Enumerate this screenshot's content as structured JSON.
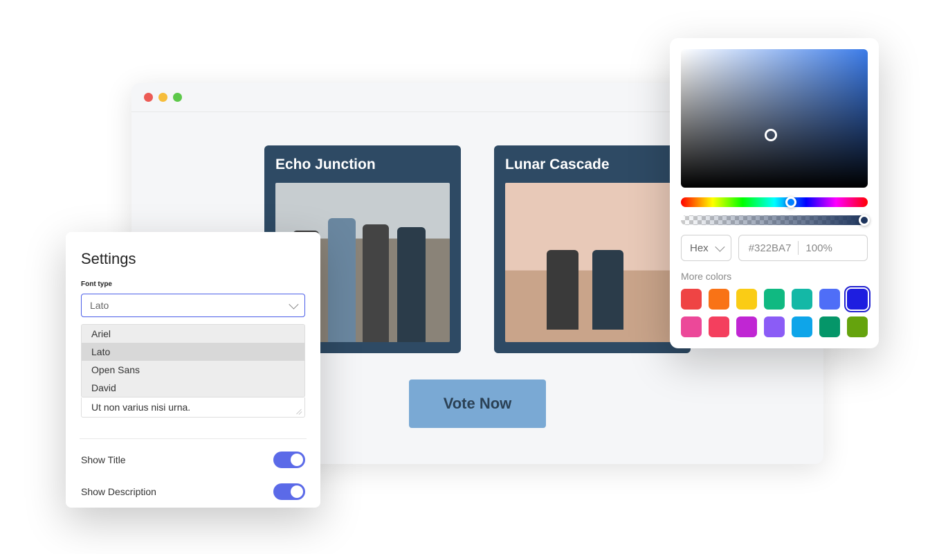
{
  "browser": {
    "cards": [
      {
        "title": "Echo Junction"
      },
      {
        "title": "Lunar Cascade"
      }
    ],
    "vote_button_label": "Vote Now"
  },
  "settings": {
    "title": "Settings",
    "font_type_label": "Font type",
    "font_selected": "Lato",
    "font_options": [
      "Ariel",
      "Lato",
      "Open Sans",
      "David"
    ],
    "textarea_value": "Ut non varius nisi urna.",
    "toggles": [
      {
        "label": "Show Title",
        "value": true
      },
      {
        "label": "Show Description",
        "value": true
      }
    ]
  },
  "color_picker": {
    "format_label": "Hex",
    "hex_value": "#322BA7",
    "opacity_value": "100%",
    "more_colors_label": "More colors",
    "swatches": [
      "#ef4444",
      "#f97316",
      "#facc15",
      "#10b981",
      "#14b8a6",
      "#4f6ef7",
      "#1e1ee0",
      "#ec4899",
      "#f43f5e",
      "#c026d3",
      "#8b5cf6",
      "#0ea5e9",
      "#059669",
      "#65a30d"
    ],
    "selected_swatch_index": 6
  }
}
